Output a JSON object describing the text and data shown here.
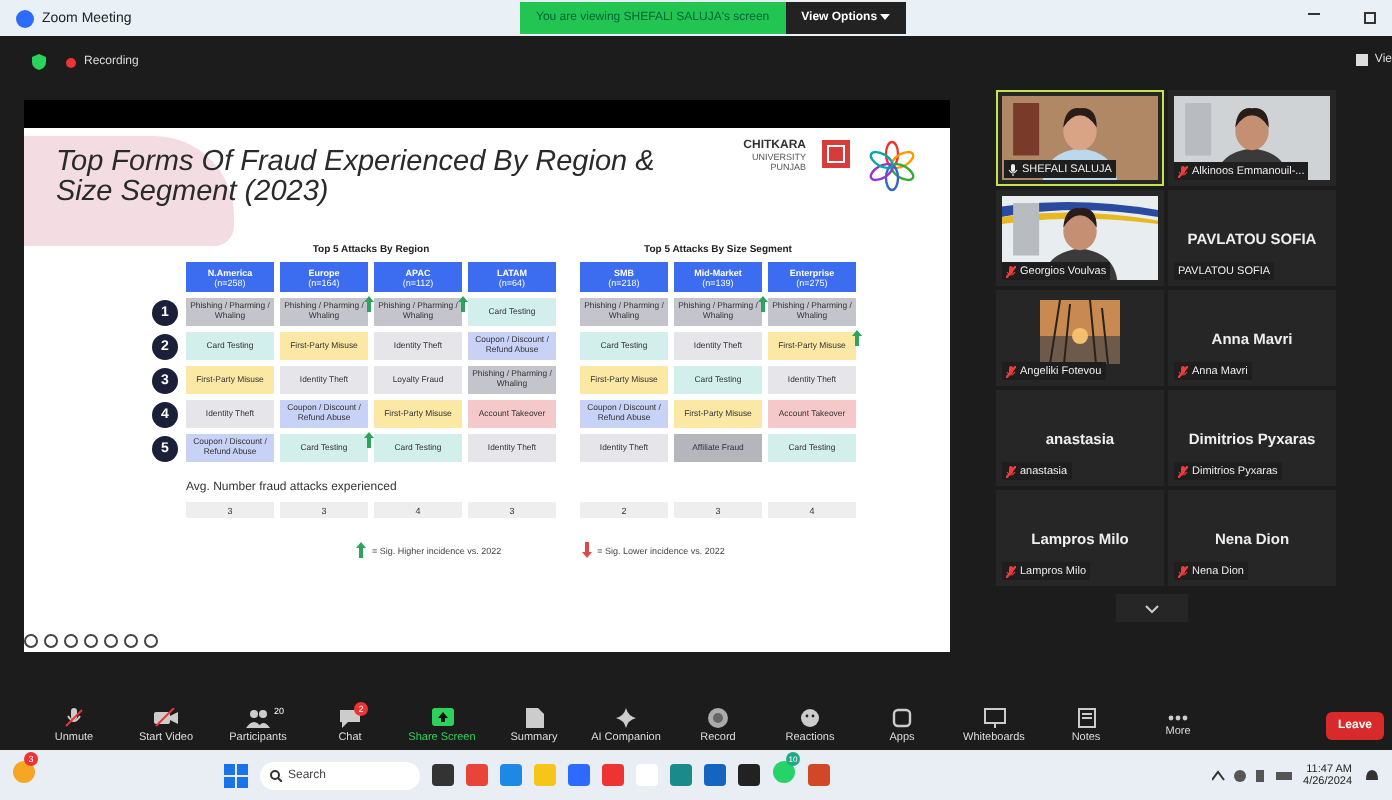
{
  "window": {
    "title": "Zoom Meeting",
    "banner": "You are viewing SHEFALI SALUJA's screen",
    "view_options": "View Options",
    "recording": "Recording",
    "view": "Vie"
  },
  "slide": {
    "title": "Top Forms Of Fraud Experienced By Region & Size Segment (2023)",
    "logo_text": "CHITKARA",
    "logo_sub": "UNIVERSITY",
    "logo_loc": "PUNJAB",
    "groups": [
      {
        "title": "Top 5 Attacks By Region",
        "columns": [
          {
            "name": "N.America",
            "n": "(n=258)"
          },
          {
            "name": "Europe",
            "n": "(n=164)"
          },
          {
            "name": "APAC",
            "n": "(n=112)"
          },
          {
            "name": "LATAM",
            "n": "(n=64)"
          }
        ]
      },
      {
        "title": "Top 5 Attacks By Size Segment",
        "columns": [
          {
            "name": "SMB",
            "n": "(n=218)"
          },
          {
            "name": "Mid-Market",
            "n": "(n=139)"
          },
          {
            "name": "Enterprise",
            "n": "(n=275)"
          }
        ]
      }
    ],
    "rows": [
      {
        "rank": "1",
        "cells": [
          {
            "text": "Phishing / Pharming / Whaling",
            "color": "#c4c5cc",
            "sig_higher": false
          },
          {
            "text": "Phishing / Pharming / Whaling",
            "color": "#c4c5cc",
            "sig_higher": true
          },
          {
            "text": "Phishing / Pharming / Whaling",
            "color": "#c4c5cc",
            "sig_higher": true
          },
          {
            "text": "Card Testing",
            "color": "#d3efec",
            "sig_higher": false
          },
          {
            "text": "Phishing / Pharming / Whaling",
            "color": "#c4c5cc",
            "sig_higher": false
          },
          {
            "text": "Phishing / Pharming / Whaling",
            "color": "#c4c5cc",
            "sig_higher": true
          },
          {
            "text": "Phishing / Pharming / Whaling",
            "color": "#c4c5cc",
            "sig_higher": false
          }
        ]
      },
      {
        "rank": "2",
        "cells": [
          {
            "text": "Card Testing",
            "color": "#d3efec",
            "sig_higher": false
          },
          {
            "text": "First-Party Misuse",
            "color": "#fbe8a4",
            "sig_higher": false
          },
          {
            "text": "Identity Theft",
            "color": "#e6e6ea",
            "sig_higher": false
          },
          {
            "text": "Coupon / Discount / Refund Abuse",
            "color": "#c8d1f6",
            "sig_higher": false
          },
          {
            "text": "Card Testing",
            "color": "#d3efec",
            "sig_higher": false
          },
          {
            "text": "Identity Theft",
            "color": "#e6e6ea",
            "sig_higher": false
          },
          {
            "text": "First-Party Misuse",
            "color": "#fbe8a4",
            "sig_higher": true
          }
        ]
      },
      {
        "rank": "3",
        "cells": [
          {
            "text": "First-Party Misuse",
            "color": "#fbe8a4",
            "sig_higher": false
          },
          {
            "text": "Identity Theft",
            "color": "#e6e6ea",
            "sig_higher": false
          },
          {
            "text": "Loyalty Fraud",
            "color": "#e6e6ea",
            "sig_higher": false
          },
          {
            "text": "Phishing / Pharming / Whaling",
            "color": "#c4c5cc",
            "sig_higher": false
          },
          {
            "text": "First-Party Misuse",
            "color": "#fbe8a4",
            "sig_higher": false
          },
          {
            "text": "Card Testing",
            "color": "#d3efec",
            "sig_higher": false
          },
          {
            "text": "Identity Theft",
            "color": "#e6e6ea",
            "sig_higher": false
          }
        ]
      },
      {
        "rank": "4",
        "cells": [
          {
            "text": "Identity Theft",
            "color": "#e6e6ea",
            "sig_higher": false
          },
          {
            "text": "Coupon / Discount / Refund Abuse",
            "color": "#c8d1f6",
            "sig_higher": false
          },
          {
            "text": "First-Party Misuse",
            "color": "#fbe8a4",
            "sig_higher": false
          },
          {
            "text": "Account Takeover",
            "color": "#f5c9c9",
            "sig_higher": false
          },
          {
            "text": "Coupon / Discount / Refund Abuse",
            "color": "#c8d1f6",
            "sig_higher": false
          },
          {
            "text": "First-Party Misuse",
            "color": "#fbe8a4",
            "sig_higher": false
          },
          {
            "text": "Account Takeover",
            "color": "#f5c9c9",
            "sig_higher": false
          }
        ]
      },
      {
        "rank": "5",
        "cells": [
          {
            "text": "Coupon / Discount / Refund Abuse",
            "color": "#c8d1f6",
            "sig_higher": false
          },
          {
            "text": "Card Testing",
            "color": "#d3efec",
            "sig_higher": true
          },
          {
            "text": "Card Testing",
            "color": "#d3efec",
            "sig_higher": false
          },
          {
            "text": "Identity Theft",
            "color": "#e6e6ea",
            "sig_higher": false
          },
          {
            "text": "Identity Theft",
            "color": "#e6e6ea",
            "sig_higher": false
          },
          {
            "text": "Affiliate Fraud",
            "color": "#b4b5bd",
            "sig_higher": false
          },
          {
            "text": "Card Testing",
            "color": "#d3efec",
            "sig_higher": false
          }
        ]
      }
    ],
    "avg_label": "Avg. Number fraud attacks experienced",
    "averages": [
      "3",
      "3",
      "4",
      "3",
      "2",
      "3",
      "4"
    ],
    "legend": [
      {
        "kind": "up",
        "text": "= Sig. Higher incidence vs. 2022"
      },
      {
        "kind": "down",
        "text": "= Sig. Lower incidence vs. 2022"
      }
    ]
  },
  "participants": [
    {
      "kind": "video",
      "name": "SHEFALI SALUJA",
      "audio_connected": true,
      "muted": false,
      "speaking": true
    },
    {
      "kind": "video",
      "name": "Alkinoos Emmanouil-...",
      "audio_connected": true,
      "muted": true,
      "speaking": false
    },
    {
      "kind": "video",
      "name": "Georgios Voulvas",
      "audio_connected": true,
      "muted": true,
      "speaking": false
    },
    {
      "kind": "name",
      "title": "PAVLATOU SOFIA",
      "name": "PAVLATOU SOFIA",
      "audio_connected": false,
      "speaking": false
    },
    {
      "name": "Angeliki Fotevou",
      "audio_connected": true,
      "muted": true,
      "speaking": false
    },
    {
      "kind": "name",
      "title": "Anna Mavri",
      "name": "Anna Mavri",
      "audio_connected": true,
      "muted": true,
      "speaking": false
    },
    {
      "kind": "name",
      "title": "anastasia",
      "name": "anastasia",
      "audio_connected": true,
      "muted": true,
      "speaking": false
    },
    {
      "kind": "name",
      "title": "Dimitrios Pyxaras",
      "name": "Dimitrios Pyxaras",
      "audio_connected": true,
      "muted": true,
      "speaking": false
    },
    {
      "kind": "name",
      "title": "Lampros Milo",
      "name": "Lampros Milo",
      "audio_connected": true,
      "muted": true,
      "speaking": false
    },
    {
      "kind": "name",
      "title": "Nena Dion",
      "name": "Nena Dion",
      "audio_connected": true,
      "muted": true,
      "speaking": false
    }
  ],
  "toolbar": [
    {
      "kind": "mic",
      "label": "Unmute"
    },
    {
      "kind": "video",
      "label": "Start Video"
    },
    {
      "kind": "participants",
      "label": "Participants",
      "count": "20"
    },
    {
      "kind": "chat",
      "label": "Chat",
      "badge": "2"
    },
    {
      "kind": "share",
      "label": "Share Screen"
    },
    {
      "kind": "summary",
      "label": "Summary"
    },
    {
      "kind": "ai",
      "label": "AI Companion"
    },
    {
      "kind": "record",
      "label": "Record"
    },
    {
      "kind": "reactions",
      "label": "Reactions"
    },
    {
      "kind": "apps",
      "label": "Apps"
    },
    {
      "kind": "whiteboards",
      "label": "Whiteboards"
    },
    {
      "kind": "notes",
      "label": "Notes"
    },
    {
      "kind": "more",
      "label": "More"
    }
  ],
  "leave": "Leave",
  "taskbar": {
    "weather_badge": "3",
    "search": "Search",
    "whatsapp_badge": "10",
    "time": "11:47 AM",
    "date": "4/26/2024"
  }
}
